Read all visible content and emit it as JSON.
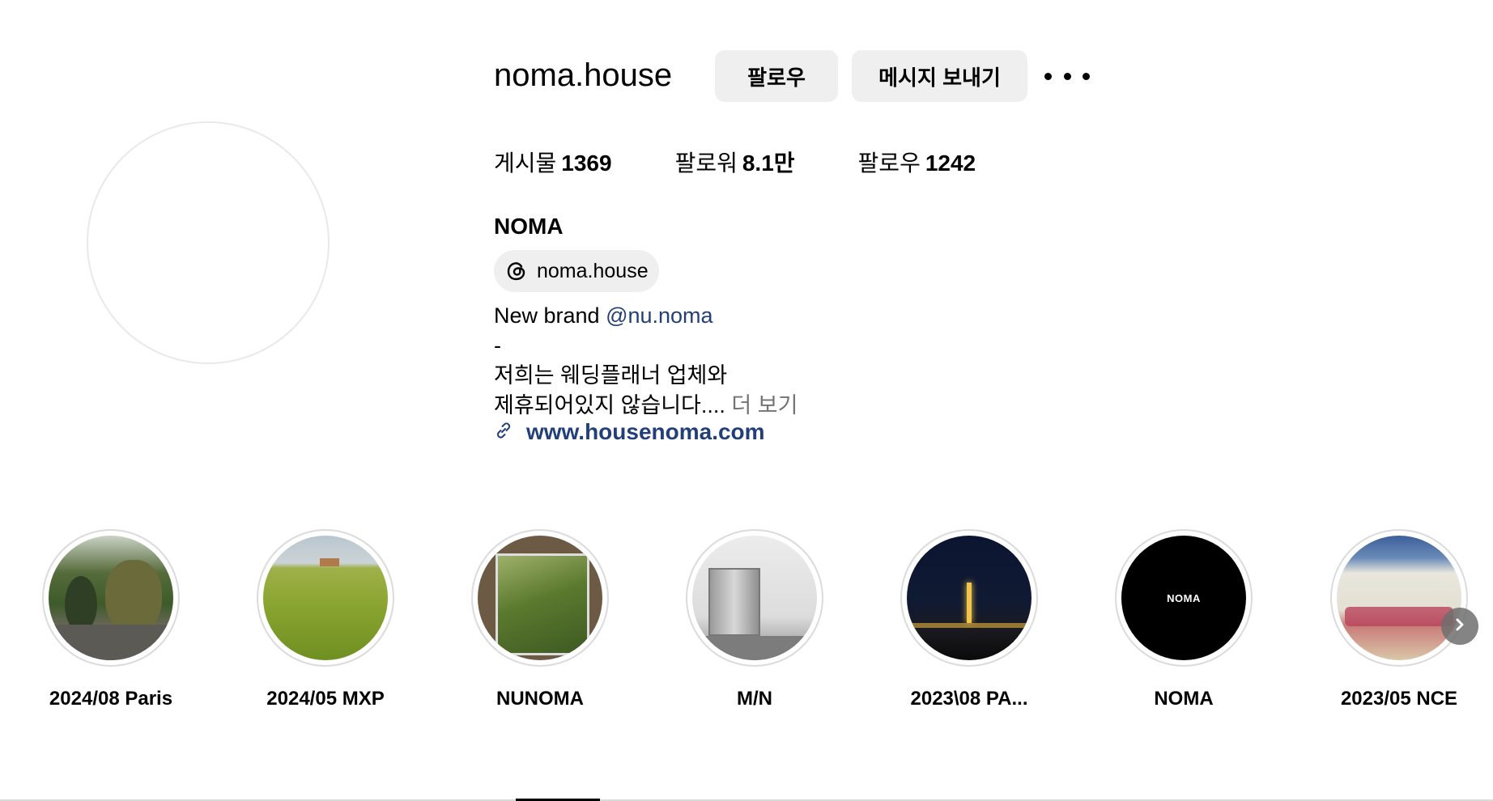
{
  "profile": {
    "username": "noma.house",
    "display_name": "NOMA",
    "follow_label": "팔로우",
    "message_label": "메시지 보내기",
    "more_icon": "more-horizontal-icon"
  },
  "stats": [
    {
      "label": "게시물",
      "value": "1369"
    },
    {
      "label": "팔로워",
      "value": "8.1만"
    },
    {
      "label": "팔로우",
      "value": "1242"
    }
  ],
  "threads": {
    "icon": "threads-icon",
    "handle": "noma.house"
  },
  "bio": {
    "line1_prefix": "New brand ",
    "mention": "@nu.noma",
    "line2": "-",
    "line3": "저희는 웨딩플래너 업체와",
    "line4": "제휴되어있지 않습니다....",
    "more": " 더 보기"
  },
  "website": {
    "icon": "link-icon",
    "url": "www.housenoma.com"
  },
  "highlights": [
    {
      "label": "2024/08 Paris"
    },
    {
      "label": "2024/05 MXP"
    },
    {
      "label": "NUNOMA"
    },
    {
      "label": "M/N"
    },
    {
      "label": "2023\\08 PA..."
    },
    {
      "label": "NOMA",
      "image_text": "NOMA"
    },
    {
      "label": "2023/05 NCE"
    }
  ],
  "next_icon": "chevron-right-icon",
  "colors": {
    "link": "#223f7a",
    "button_bg": "#efefef",
    "muted": "#737373"
  }
}
